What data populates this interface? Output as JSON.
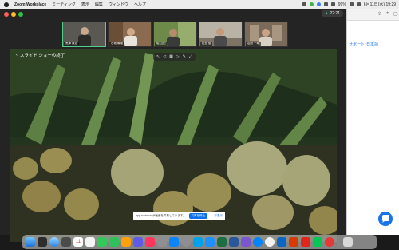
{
  "menubar": {
    "app_name": "Zoom Workplace",
    "items": [
      "ミーティング",
      "表示",
      "編集",
      "ウィンドウ",
      "ヘルプ"
    ],
    "battery": "99%",
    "datetime": "6月11日(水) 19:29"
  },
  "meeting": {
    "timer": "22:21",
    "participants": [
      {
        "name": "黒澤 康治"
      },
      {
        "name": "石坂 義継"
      },
      {
        "name": "堀 山田"
      },
      {
        "name": "松島 優"
      },
      {
        "name": "岩田 千尋"
      }
    ],
    "exit_slideshow_label": "スライド ショーの終了"
  },
  "notice": {
    "text": "app.zoom.us が画面を共有しています。",
    "stop_label": "共有を停止",
    "hide_label": "非表示"
  },
  "browser": {
    "menu_item_1": "サポート",
    "menu_item_2": "日本語"
  },
  "dock": {
    "calendar_day": "11"
  },
  "colors": {
    "active_speaker_border": "#4fd18b",
    "zoom_blue": "#0e71eb",
    "browser_link": "#1a73e8"
  }
}
